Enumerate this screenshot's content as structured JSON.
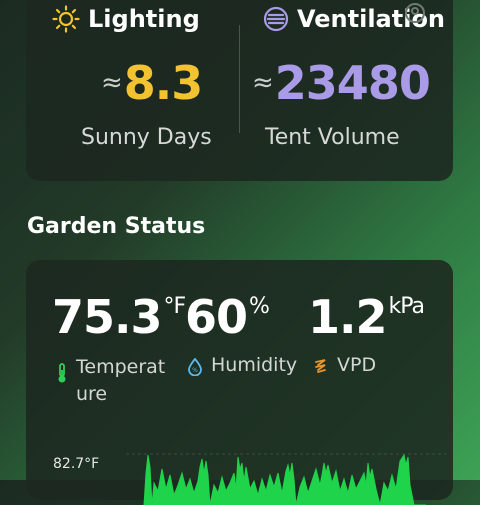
{
  "top_card": {
    "lighting": {
      "title": "Lighting",
      "approx": "≈",
      "value": "8.3",
      "label": "Sunny Days",
      "icon": "sun-icon",
      "color": "#f2c230"
    },
    "ventilation": {
      "title": "Ventilation",
      "approx": "≈",
      "value": "23480",
      "label": "Tent Volume",
      "icon": "vent-icon",
      "color": "#a99be8"
    }
  },
  "section_title": "Garden Status",
  "status": {
    "temperature": {
      "value": "75.3",
      "unit": "°F",
      "label": "Temperature",
      "icon": "thermometer-icon"
    },
    "humidity": {
      "value": "60",
      "unit": "%",
      "label": "Humidity",
      "icon": "droplet-icon"
    },
    "vpd": {
      "value": "1.2",
      "unit": "kPa",
      "label": "VPD",
      "icon": "wave-icon"
    }
  },
  "chart": {
    "max_label": "82.7°F",
    "color": "#1fd34a"
  }
}
